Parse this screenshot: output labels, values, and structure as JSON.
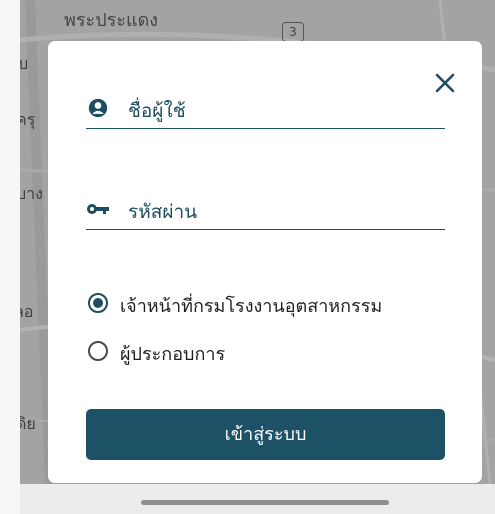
{
  "map": {
    "labels": [
      "พระประแดง",
      "บ",
      "ครุ",
      "บาง",
      "ลอ",
      "ดิย"
    ],
    "road_badge": "3"
  },
  "login": {
    "close_icon": "close-icon",
    "username": {
      "icon": "user-circle-icon",
      "placeholder": "ชื่อผู้ใช้"
    },
    "password": {
      "icon": "key-icon",
      "placeholder": "รหัสผ่าน"
    },
    "roles": [
      {
        "label": "เจ้าหน้าที่กรมโรงงานอุตสาหกรรม",
        "checked": true
      },
      {
        "label": "ผู้ประกอบการ",
        "checked": false
      }
    ],
    "submit_label": "เข้าสู่ระบบ"
  },
  "colors": {
    "primary": "#1d5166",
    "overlay": "#a3a3a3",
    "text": "#1f1f1f"
  }
}
